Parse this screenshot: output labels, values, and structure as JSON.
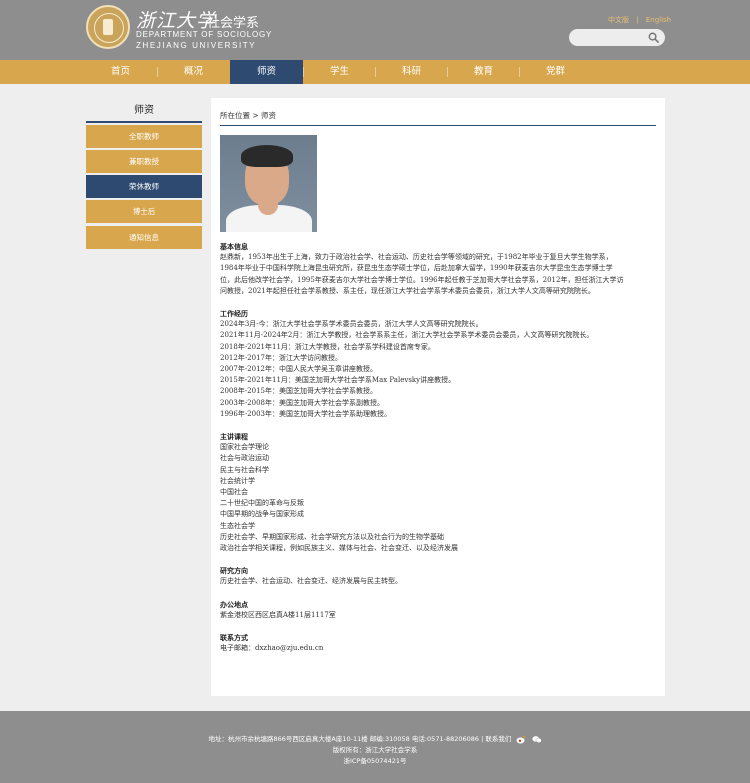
{
  "header": {
    "logo_cn": "浙江大学",
    "dept_cn": "社会学系",
    "dept_en1": "DEPARTMENT OF SOCIOLOGY",
    "dept_en2": "ZHEJIANG UNIVERSITY",
    "lang_cn": "中文版",
    "lang_en": "English",
    "search_placeholder": ""
  },
  "nav": {
    "items": [
      "首页",
      "概况",
      "师资",
      "学生",
      "科研",
      "教育",
      "党群"
    ],
    "active_index": 2
  },
  "sidebar": {
    "title": "师资",
    "items": [
      "全职教师",
      "兼职教授",
      "荣休教师",
      "博士后",
      "通知信息"
    ],
    "active_index": 2
  },
  "main": {
    "breadcrumb": "所在位置 > 师资",
    "sections": [
      {
        "title": "基本信息",
        "lines": [
          "赵鼎新，1953年出生于上海，致力于政治社会学、社会运动、历史社会学等领域的研究，于1982年毕业于复旦大学生物学系，",
          "1984年毕业于中国科学院上海昆虫研究所，获昆虫生态学硕士学位，后赴加拿大留学，1990年获麦吉尔大学昆虫生态学博士学",
          "位，此后他改学社会学，1995年获麦吉尔大学社会学博士学位。1996年起任教于芝加哥大学社会学系，2012年，担任浙江大学访",
          "问教授，2021年起担任社会学系教授、系主任，现任浙江大学社会学系学术委员会委员，浙江大学人文高等研究院院长。"
        ]
      },
      {
        "title": "工作经历",
        "lines": [
          "2024年3月-今：浙江大学社会学系学术委员会委员，浙江大学人文高等研究院院长。",
          "2021年11月-2024年2月：浙江大学教授，社会学系系主任，浙江大学社会学系学术委员会委员，人文高等研究院院长。",
          "2018年-2021年11月：浙江大学教授，社会学系学科建设首席专家。",
          "2012年-2017年：浙江大学访问教授。",
          "2007年-2012年：中国人民大学吴玉章讲座教授。",
          "2015年-2021年11月：美国芝加哥大学社会学系Max Palevsky讲座教授。",
          "2008年-2015年：美国芝加哥大学社会学系教授。",
          "2003年-2008年：美国芝加哥大学社会学系副教授。",
          "1996年-2003年：美国芝加哥大学社会学系助理教授。"
        ]
      },
      {
        "title": "主讲课程",
        "lines": [
          "国家社会学理论",
          "社会与政治运动",
          "民主与社会科学",
          "社会统计学",
          "中国社会",
          "二十世纪中国的革命与反叛",
          "中国早期的战争与国家形成",
          "生态社会学",
          "历史社会学、早期国家形成、社会学研究方法以及社会行为的生物学基础",
          "政治社会学相关课程，例如民族主义、媒体与社会、社会变迁、以及经济发展"
        ]
      },
      {
        "title": "研究方向",
        "lines": [
          "历史社会学、社会运动、社会变迁、经济发展与民主转型。"
        ]
      },
      {
        "title": "办公地点",
        "lines": [
          "紫金港校区西区启真A楼11层1117室"
        ]
      },
      {
        "title": "联系方式",
        "lines": [
          "电子邮箱：dxzhao@zju.edu.cn"
        ]
      }
    ]
  },
  "footer": {
    "address": "地址：杭州市余杭塘路866号西区启真大楼A座10-11楼 邮编:310058 电话:0571-88206086 | 联系我们",
    "copyright": "版权所有：浙江大学社会学系",
    "icp": "浙ICP备05074421号"
  },
  "colors": {
    "gold": "#d8a74d",
    "navy": "#2f4a70",
    "gray": "#8e8e8e"
  }
}
